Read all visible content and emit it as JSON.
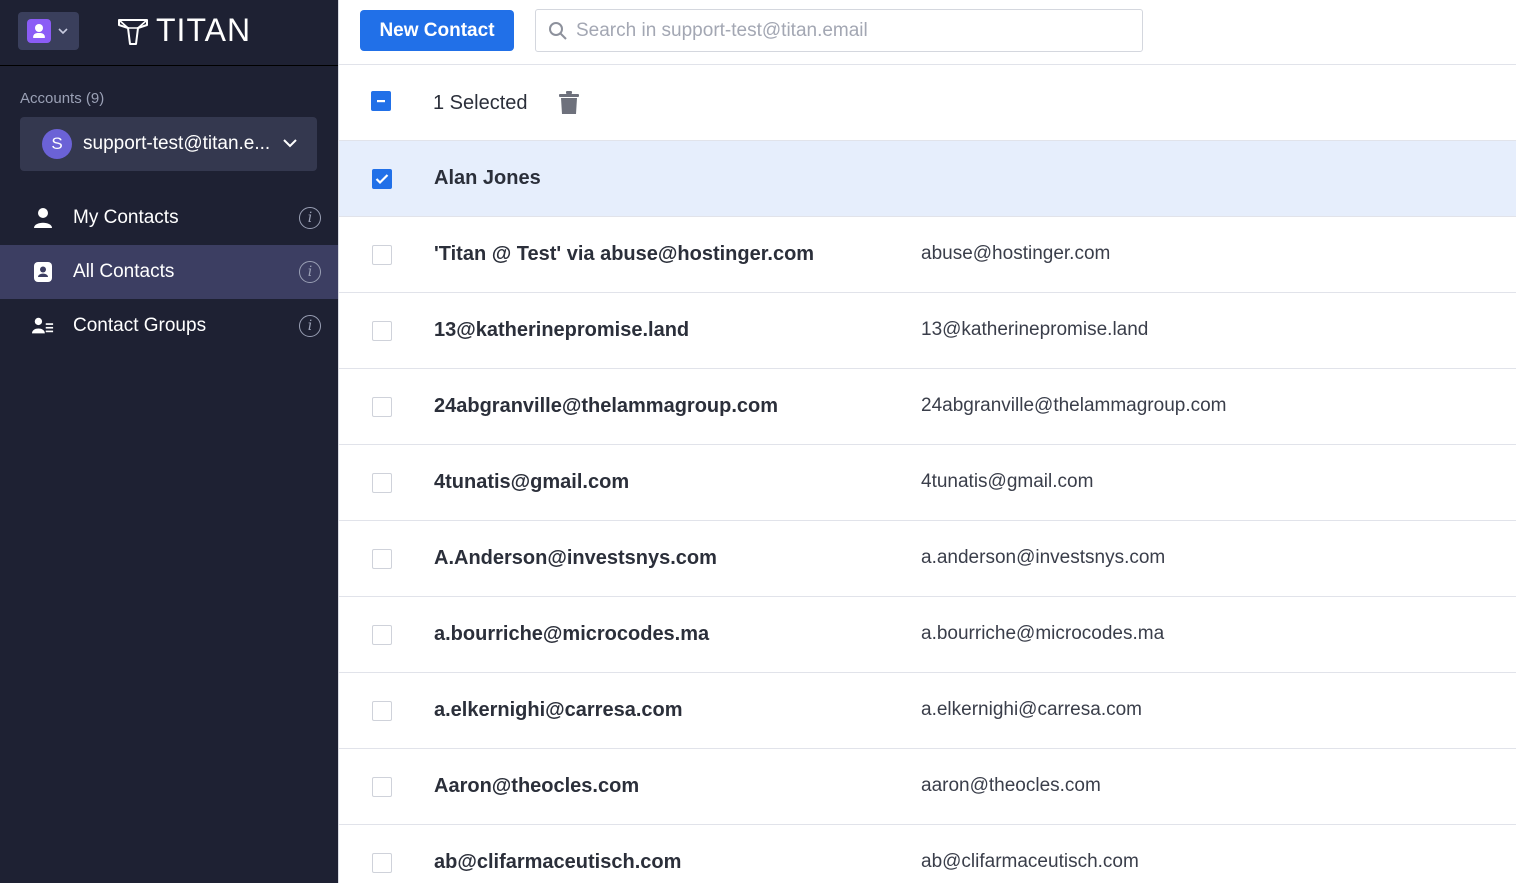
{
  "sidebar": {
    "app_switcher_icon": "contacts-app-icon",
    "brand": "TITAN",
    "accounts_label": "Accounts (9)",
    "account": {
      "avatar_letter": "S",
      "name": "support-test@titan.e..."
    },
    "nav": [
      {
        "label": "My Contacts",
        "icon": "person-icon",
        "active": false
      },
      {
        "label": "All Contacts",
        "icon": "contact-book-icon",
        "active": true
      },
      {
        "label": "Contact Groups",
        "icon": "group-icon",
        "active": false
      }
    ],
    "colors": {
      "background": "#1e2133",
      "active_item": "#3c3e62",
      "avatar": "#6b62d6"
    }
  },
  "toolbar": {
    "new_contact_label": "New Contact",
    "search_placeholder": "Search in support-test@titan.email",
    "accent": "#2170e8"
  },
  "selection": {
    "label": "1 Selected",
    "state": "indeterminate"
  },
  "contacts": [
    {
      "name": "Alan Jones",
      "email": "",
      "checked": true
    },
    {
      "name": "'Titan @ Test' via abuse@hostinger.com",
      "email": "abuse@hostinger.com",
      "checked": false
    },
    {
      "name": "13@katherinepromise.land",
      "email": "13@katherinepromise.land",
      "checked": false
    },
    {
      "name": "24abgranville@thelammagroup.com",
      "email": "24abgranville@thelammagroup.com",
      "checked": false
    },
    {
      "name": "4tunatis@gmail.com",
      "email": "4tunatis@gmail.com",
      "checked": false
    },
    {
      "name": "A.Anderson@investsnys.com",
      "email": "a.anderson@investsnys.com",
      "checked": false
    },
    {
      "name": "a.bourriche@microcodes.ma",
      "email": "a.bourriche@microcodes.ma",
      "checked": false
    },
    {
      "name": "a.elkernighi@carresa.com",
      "email": "a.elkernighi@carresa.com",
      "checked": false
    },
    {
      "name": "Aaron@theocles.com",
      "email": "aaron@theocles.com",
      "checked": false
    },
    {
      "name": "ab@clifarmaceutisch.com",
      "email": "ab@clifarmaceutisch.com",
      "checked": false
    }
  ]
}
